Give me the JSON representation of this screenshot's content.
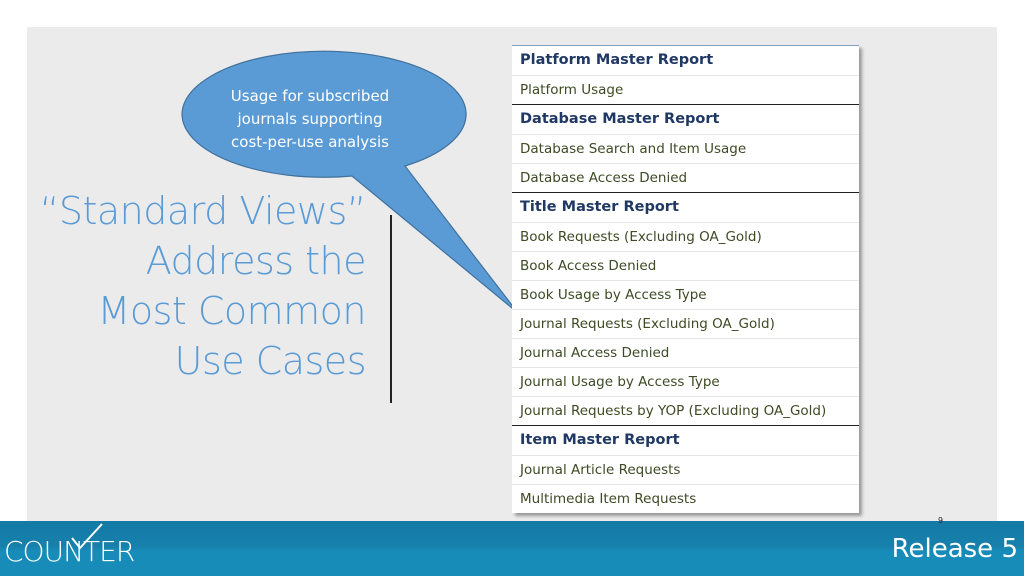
{
  "slide": {
    "title_lines": [
      "“Standard Views”",
      "Address the",
      "Most Common",
      "Use Cases"
    ],
    "callout": {
      "lines": [
        "Usage for subscribed",
        "journals supporting",
        "cost-per-use analysis"
      ],
      "fill_color": "#5b9bd5",
      "points_to": "Journal Requests (Excluding OA_Gold)"
    },
    "slide_number": "9"
  },
  "report_table": {
    "groups": [
      {
        "header": "Platform Master Report",
        "items": [
          "Platform Usage"
        ]
      },
      {
        "header": "Database Master Report",
        "items": [
          "Database Search and Item Usage",
          "Database Access Denied"
        ]
      },
      {
        "header": "Title Master Report",
        "items": [
          "Book Requests (Excluding OA_Gold)",
          "Book Access Denied",
          "Book Usage by Access Type",
          "Journal Requests (Excluding OA_Gold)",
          "Journal Access Denied",
          "Journal Usage by Access Type",
          "Journal Requests by YOP (Excluding OA_Gold)"
        ]
      },
      {
        "header": "Item Master Report",
        "items": [
          "Journal Article Requests",
          "Multimedia Item Requests"
        ]
      }
    ]
  },
  "footer": {
    "logo_text": "COUNTER",
    "release_label": "Release 5",
    "band_color": "#178cb8"
  },
  "colors": {
    "title": "#5b9bd5",
    "header_text": "#1f3864",
    "item_text": "#3d4a24"
  }
}
